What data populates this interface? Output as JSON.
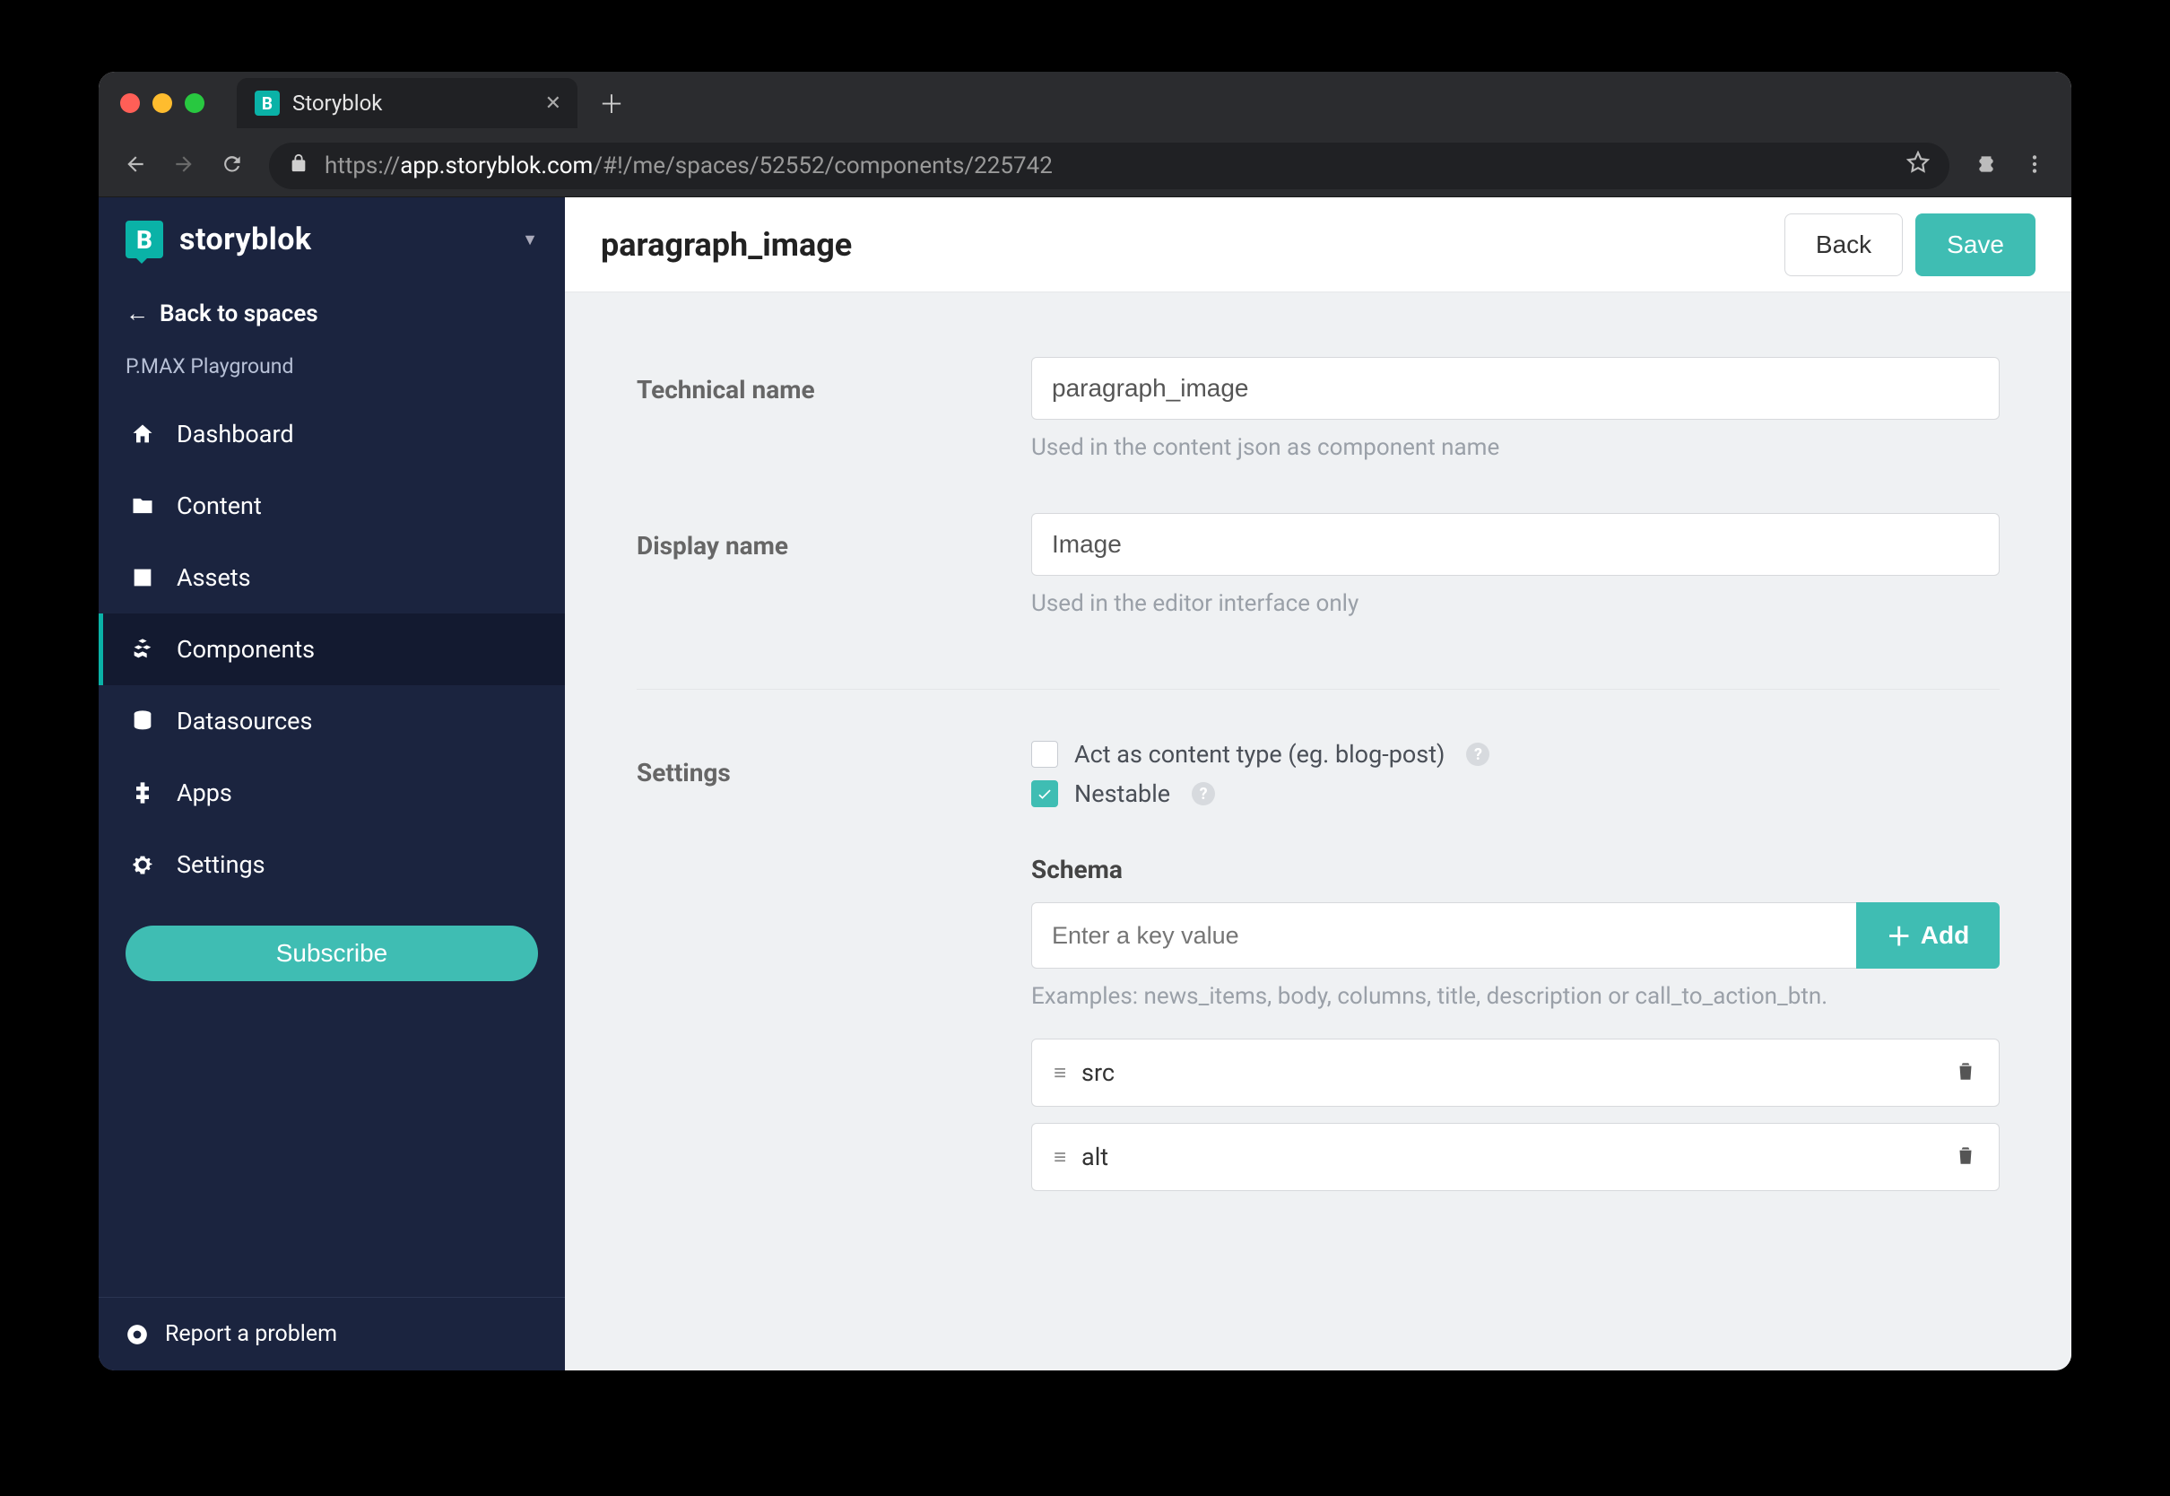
{
  "browser": {
    "tab_title": "Storyblok",
    "url_prefix": "https://",
    "url_host": "app.storyblok.com",
    "url_path": "/#!/me/spaces/52552/components/225742"
  },
  "brand": {
    "name": "storyblok",
    "logo_letter": "B"
  },
  "sidebar": {
    "back_label": "Back to spaces",
    "space_name": "P.MAX Playground",
    "items": [
      {
        "label": "Dashboard"
      },
      {
        "label": "Content"
      },
      {
        "label": "Assets"
      },
      {
        "label": "Components"
      },
      {
        "label": "Datasources"
      },
      {
        "label": "Apps"
      },
      {
        "label": "Settings"
      }
    ],
    "subscribe": "Subscribe",
    "report": "Report a problem"
  },
  "topbar": {
    "title": "paragraph_image",
    "back": "Back",
    "save": "Save"
  },
  "form": {
    "technical_name_label": "Technical name",
    "technical_name_value": "paragraph_image",
    "technical_name_help": "Used in the content json as component name",
    "display_name_label": "Display name",
    "display_name_value": "Image",
    "display_name_help": "Used in the editor interface only",
    "settings_label": "Settings",
    "content_type_label": "Act as content type (eg. blog-post)",
    "nestable_label": "Nestable",
    "schema_heading": "Schema",
    "schema_placeholder": "Enter a key value",
    "schema_add": "Add",
    "schema_examples": "Examples: news_items, body, columns, title, description or call_to_action_btn.",
    "schema_items": [
      {
        "name": "src"
      },
      {
        "name": "alt"
      }
    ]
  }
}
